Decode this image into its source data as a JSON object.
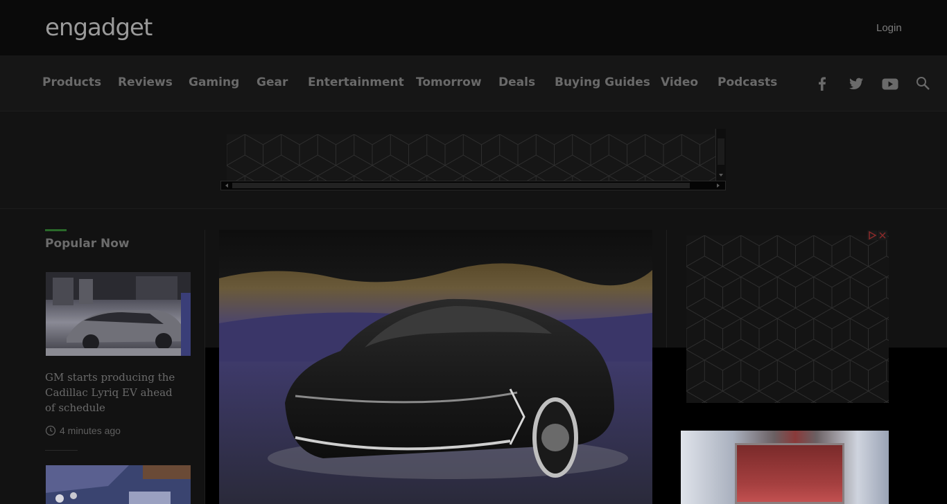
{
  "header": {
    "logo_text": "engadget",
    "login_label": "Login"
  },
  "nav": {
    "items": [
      {
        "label": "Products"
      },
      {
        "label": "Reviews"
      },
      {
        "label": "Gaming"
      },
      {
        "label": "Gear"
      },
      {
        "label": "Entertainment"
      },
      {
        "label": "Tomorrow"
      },
      {
        "label": "Deals"
      },
      {
        "label": "Buying Guides"
      },
      {
        "label": "Video"
      },
      {
        "label": "Podcasts"
      }
    ],
    "social_icons": [
      "facebook-icon",
      "twitter-icon",
      "youtube-icon",
      "search-icon"
    ]
  },
  "popular": {
    "heading": "Popular Now",
    "stories": [
      {
        "title": "GM starts producing the Cadillac Lyriq EV ahead of schedule",
        "time": "4 minutes ago"
      }
    ]
  },
  "colors": {
    "accent": "#2a6a2a",
    "background": "#000000"
  }
}
